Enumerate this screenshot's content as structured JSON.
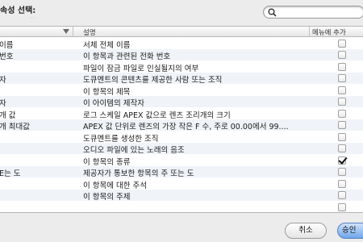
{
  "header": {
    "title": "속성 선택:",
    "faint_text": "···"
  },
  "search": {
    "placeholder": ""
  },
  "table": {
    "columns": [
      "",
      "설명",
      "메뉴에 추가"
    ],
    "rows": [
      {
        "name": "이름",
        "desc": "서체 전체 이름",
        "checked": false
      },
      {
        "name": "번호",
        "desc": "이 항목과 관련된 전화 번호",
        "checked": false
      },
      {
        "name": "",
        "desc": "파일이 잠금 파일로 인실될지의 여부",
        "checked": false
      },
      {
        "name": "자",
        "desc": "도큐멘트의 콘텐츠를 제공한 사람 또는 조직",
        "checked": false
      },
      {
        "name": "",
        "desc": "이 항목의 제목",
        "checked": false
      },
      {
        "name": "자",
        "desc": "이 아이템의 제작자",
        "checked": false
      },
      {
        "name": "개 값",
        "desc": "로그 스케일 APEX 값으로 렌즈 조리개의 크기",
        "checked": false
      },
      {
        "name": "개 최대값",
        "desc": "APEX 값 단위로 렌즈의 가장 작은 F 수, 주로 00.00에서 99....",
        "checked": false
      },
      {
        "name": "",
        "desc": "도큐멘트를 생성한 조직",
        "checked": false
      },
      {
        "name": "",
        "desc": "오디오 파일에 있는 노래의 음조",
        "checked": false
      },
      {
        "name": "",
        "desc": "이 항목의 종류",
        "checked": true
      },
      {
        "name": "E는 도",
        "desc": "제공자가 통보한 항목의 주 또는 도",
        "checked": false
      },
      {
        "name": "",
        "desc": "이 항목에 대한 주석",
        "checked": false
      },
      {
        "name": "",
        "desc": "이 항목의 주제",
        "checked": false
      },
      {
        "name": "",
        "desc": "",
        "checked": false
      }
    ]
  },
  "buttons": {
    "cancel": "취소",
    "ok": "승인"
  }
}
